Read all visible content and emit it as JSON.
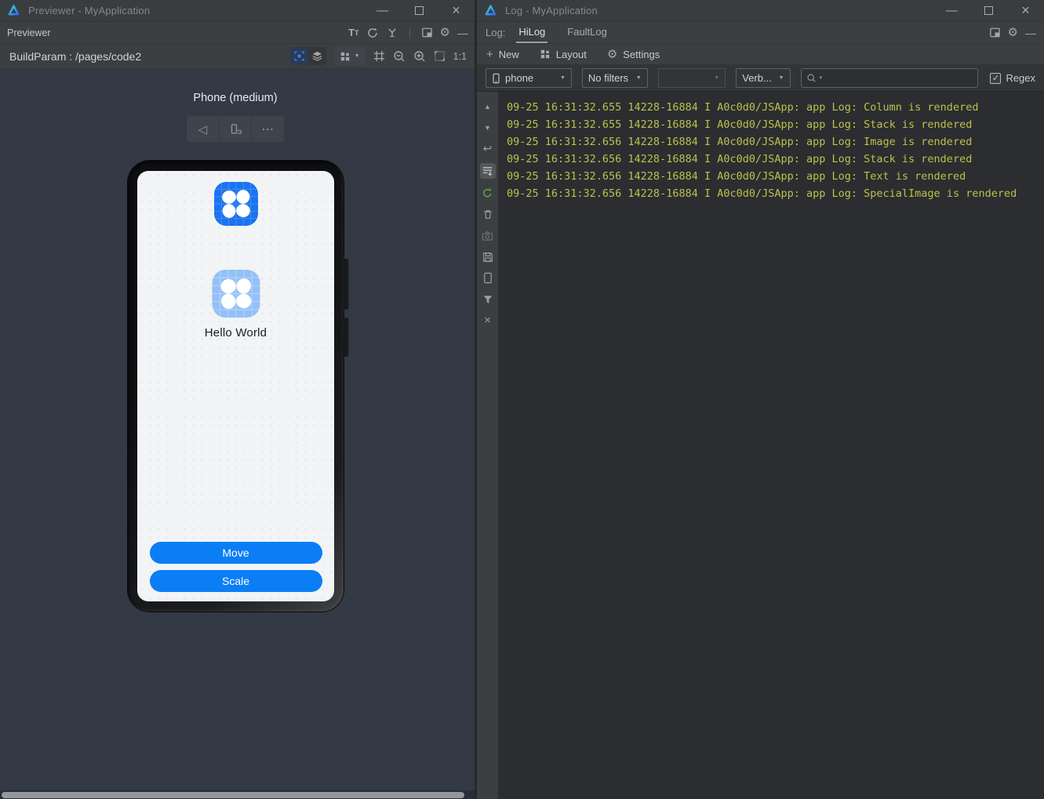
{
  "glyphs": {
    "minimize": "—",
    "close": "×",
    "caret": "▼",
    "plus": "+",
    "check": "✓",
    "up_triangle": "▲",
    "down_triangle": "▼",
    "soft_wrap": "↩",
    "gear": "⚙",
    "more_ellipsis": "⋯",
    "back_triangle": "◁",
    "t_big": "T",
    "t_small": "T",
    "search_caret": "▼"
  },
  "left_window": {
    "title": "Previewer - MyApplication",
    "panel_label": "Previewer",
    "buildparam_label": "BuildParam : /pages/code2",
    "zoom_ratio_label": "1:1",
    "device_title": "Phone (medium)",
    "phone": {
      "app_name": "Hello World",
      "move_button": "Move",
      "scale_button": "Scale"
    }
  },
  "right_window": {
    "title": "Log - MyApplication",
    "log_label": "Log:",
    "tab_hilog": "HiLog",
    "tab_faultlog": "FaultLog",
    "toolbar": {
      "new_label": "New",
      "layout_label": "Layout",
      "settings_label": "Settings"
    },
    "filters": {
      "device": "phone",
      "process": "No filters",
      "tag": "",
      "level": "Verb...",
      "search_placeholder": "",
      "search_value": "",
      "regex_label": "Regex"
    },
    "log_lines": [
      "09-25 16:31:32.655 14228-16884 I A0c0d0/JSApp: app Log: Column is rendered",
      "09-25 16:31:32.655 14228-16884 I A0c0d0/JSApp: app Log: Stack is rendered",
      "09-25 16:31:32.656 14228-16884 I A0c0d0/JSApp: app Log: Image is rendered",
      "09-25 16:31:32.656 14228-16884 I A0c0d0/JSApp: app Log: Stack is rendered",
      "09-25 16:31:32.656 14228-16884 I A0c0d0/JSApp: app Log: Text is rendered",
      "09-25 16:31:32.656 14228-16884 I A0c0d0/JSApp: app Log: SpecialImage is rendered"
    ]
  },
  "colors": {
    "accent_blue": "#3d7bf4",
    "app_icon_blue": "#1a73f0",
    "app_icon_light_blue": "#93c0f7",
    "pill_button_blue": "#0b7ef5",
    "log_text_olive": "#bdc14b",
    "preview_background": "#333945",
    "chrome_background": "#3c3f41"
  }
}
